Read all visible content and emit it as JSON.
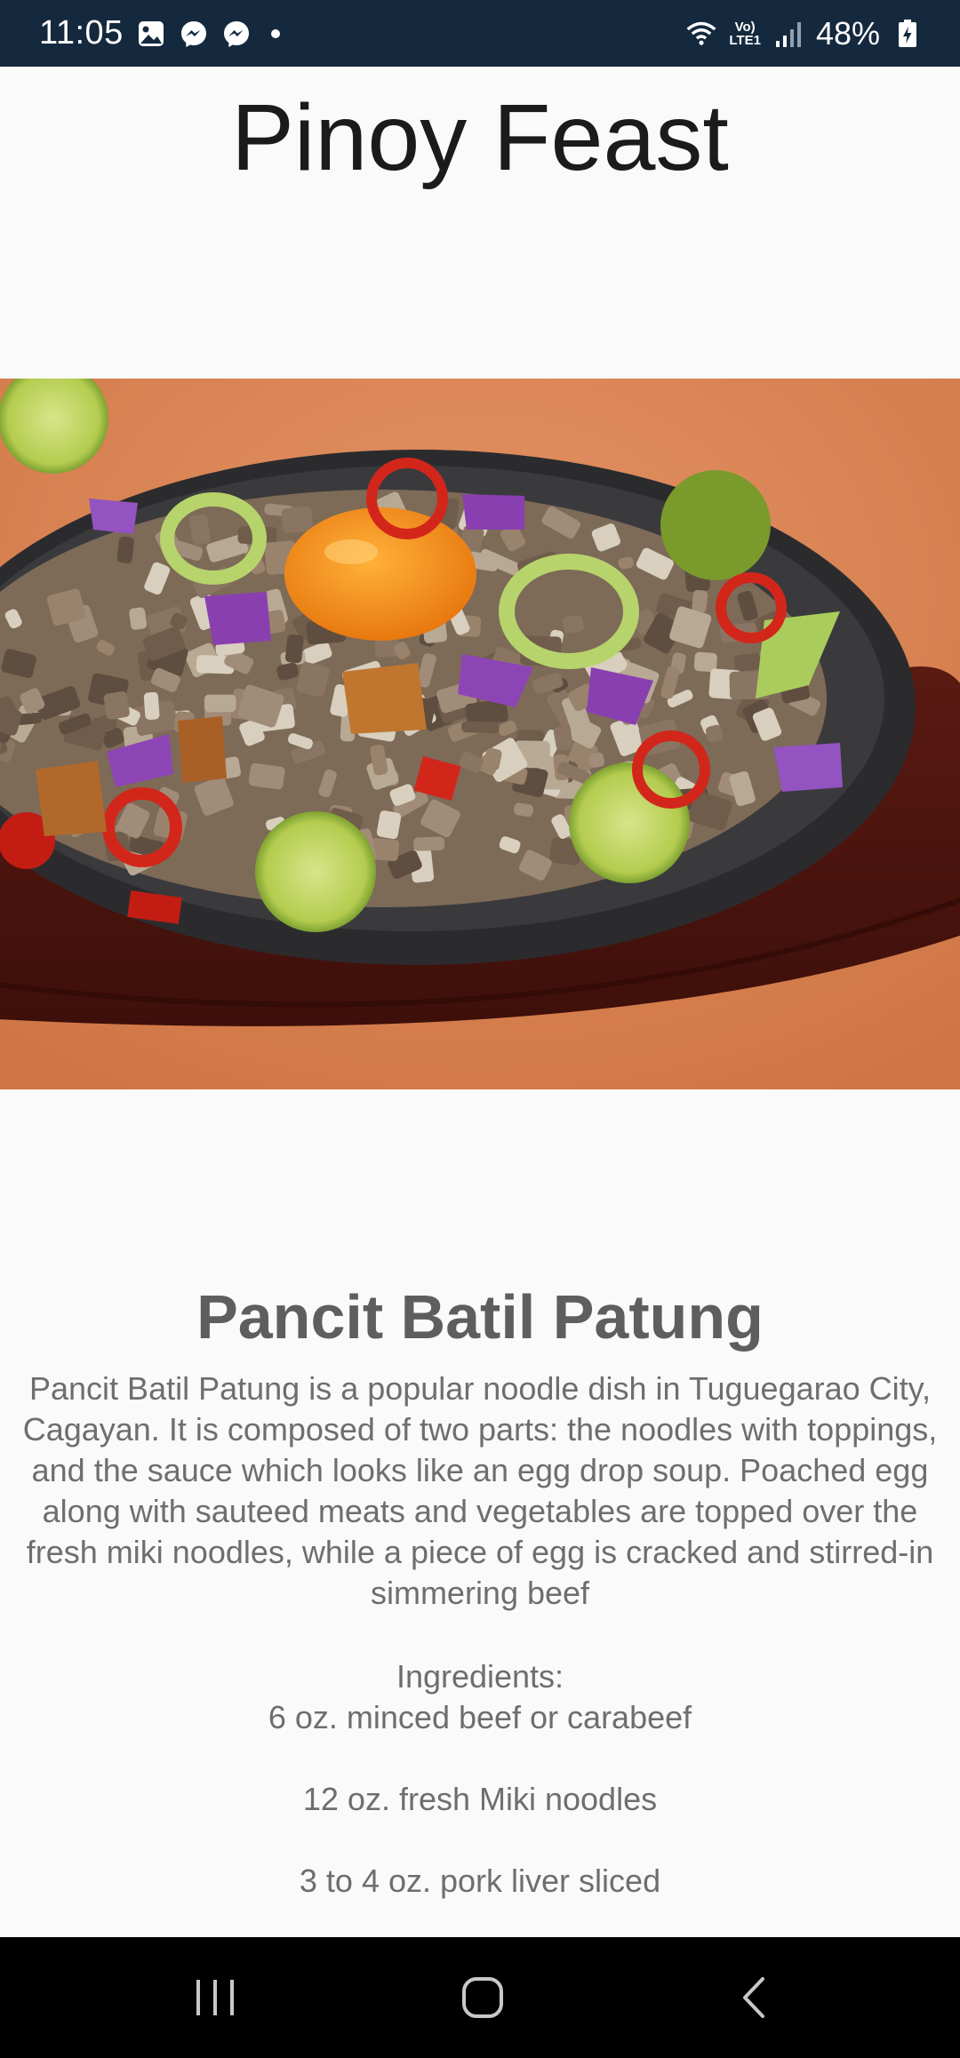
{
  "status_bar": {
    "time": "11:05",
    "battery": "48%",
    "network_label_top": "Vo)",
    "network_label_bottom": "LTE1",
    "icons_left": [
      "gallery-icon",
      "messenger-icon",
      "messenger-icon",
      "dot-icon"
    ],
    "icons_right": [
      "wifi-icon",
      "volte-icon",
      "signal-icon",
      "battery-icon"
    ]
  },
  "app": {
    "title": "Pinoy Feast"
  },
  "recipe": {
    "name": "Pancit Batil Patung",
    "description": "Pancit Batil Patung is a popular noodle dish in Tuguegarao City, Cagayan. It is composed of two parts: the noodles with toppings, and the sauce which looks like an egg drop soup. Poached egg along with sauteed meats and vegetables are topped over the fresh miki noodles, while a piece of egg is cracked and stirred-in simmering beef",
    "ingredients_label": "Ingredients:",
    "ingredients": [
      "6 oz. minced beef or carabeef",
      "12 oz. fresh Miki noodles",
      "3 to 4 oz. pork liver sliced"
    ]
  },
  "nav_bar": {
    "buttons": [
      "recent-apps",
      "home",
      "back"
    ]
  }
}
